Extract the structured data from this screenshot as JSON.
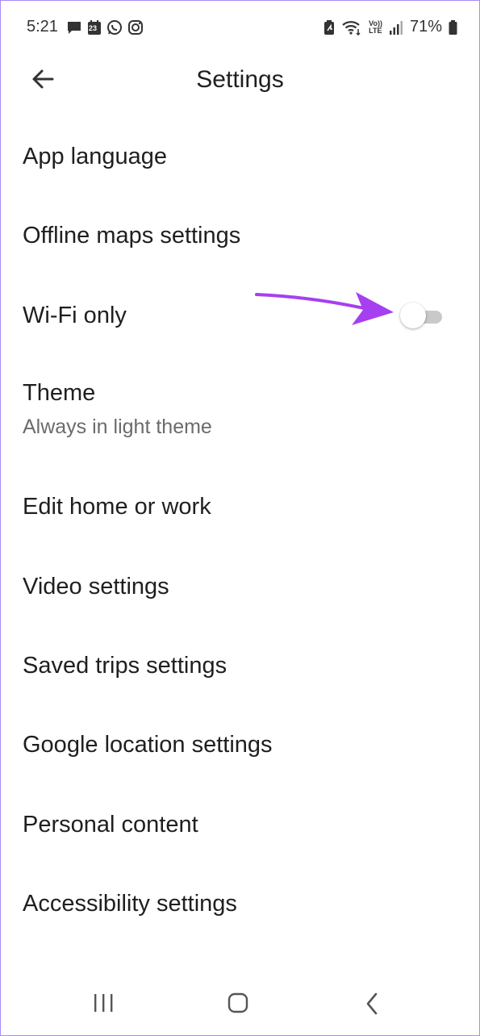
{
  "status_bar": {
    "time": "5:21",
    "battery": "71%",
    "left_icons": [
      "message-icon",
      "calendar-icon",
      "whatsapp-icon",
      "instagram-icon"
    ],
    "right_icons": [
      "battery-saver-icon",
      "wifi-icon",
      "volte-icon",
      "signal-icon",
      "battery-icon"
    ],
    "calendar_day": "23",
    "volte_top": "Vo))",
    "volte_bottom": "LTE"
  },
  "header": {
    "title": "Settings",
    "back_icon": "arrow-left-icon"
  },
  "settings": {
    "items": [
      {
        "label": "App language"
      },
      {
        "label": "Offline maps settings"
      },
      {
        "label": "Wi-Fi only",
        "toggle": false
      },
      {
        "label": "Theme",
        "subtitle": "Always in light theme"
      },
      {
        "label": "Edit home or work"
      },
      {
        "label": "Video settings"
      },
      {
        "label": "Saved trips settings"
      },
      {
        "label": "Google location settings"
      },
      {
        "label": "Personal content"
      },
      {
        "label": "Accessibility settings"
      }
    ]
  },
  "annotation": {
    "arrow_color": "#a63ff0"
  },
  "nav_bar": {
    "buttons": [
      "recents-icon",
      "home-icon",
      "back-icon"
    ]
  },
  "colors": {
    "frame": "#a78bfa",
    "text": "#1f1f1f",
    "subtext": "#6b6b6b",
    "toggle_track_off": "#c9c9c9"
  }
}
